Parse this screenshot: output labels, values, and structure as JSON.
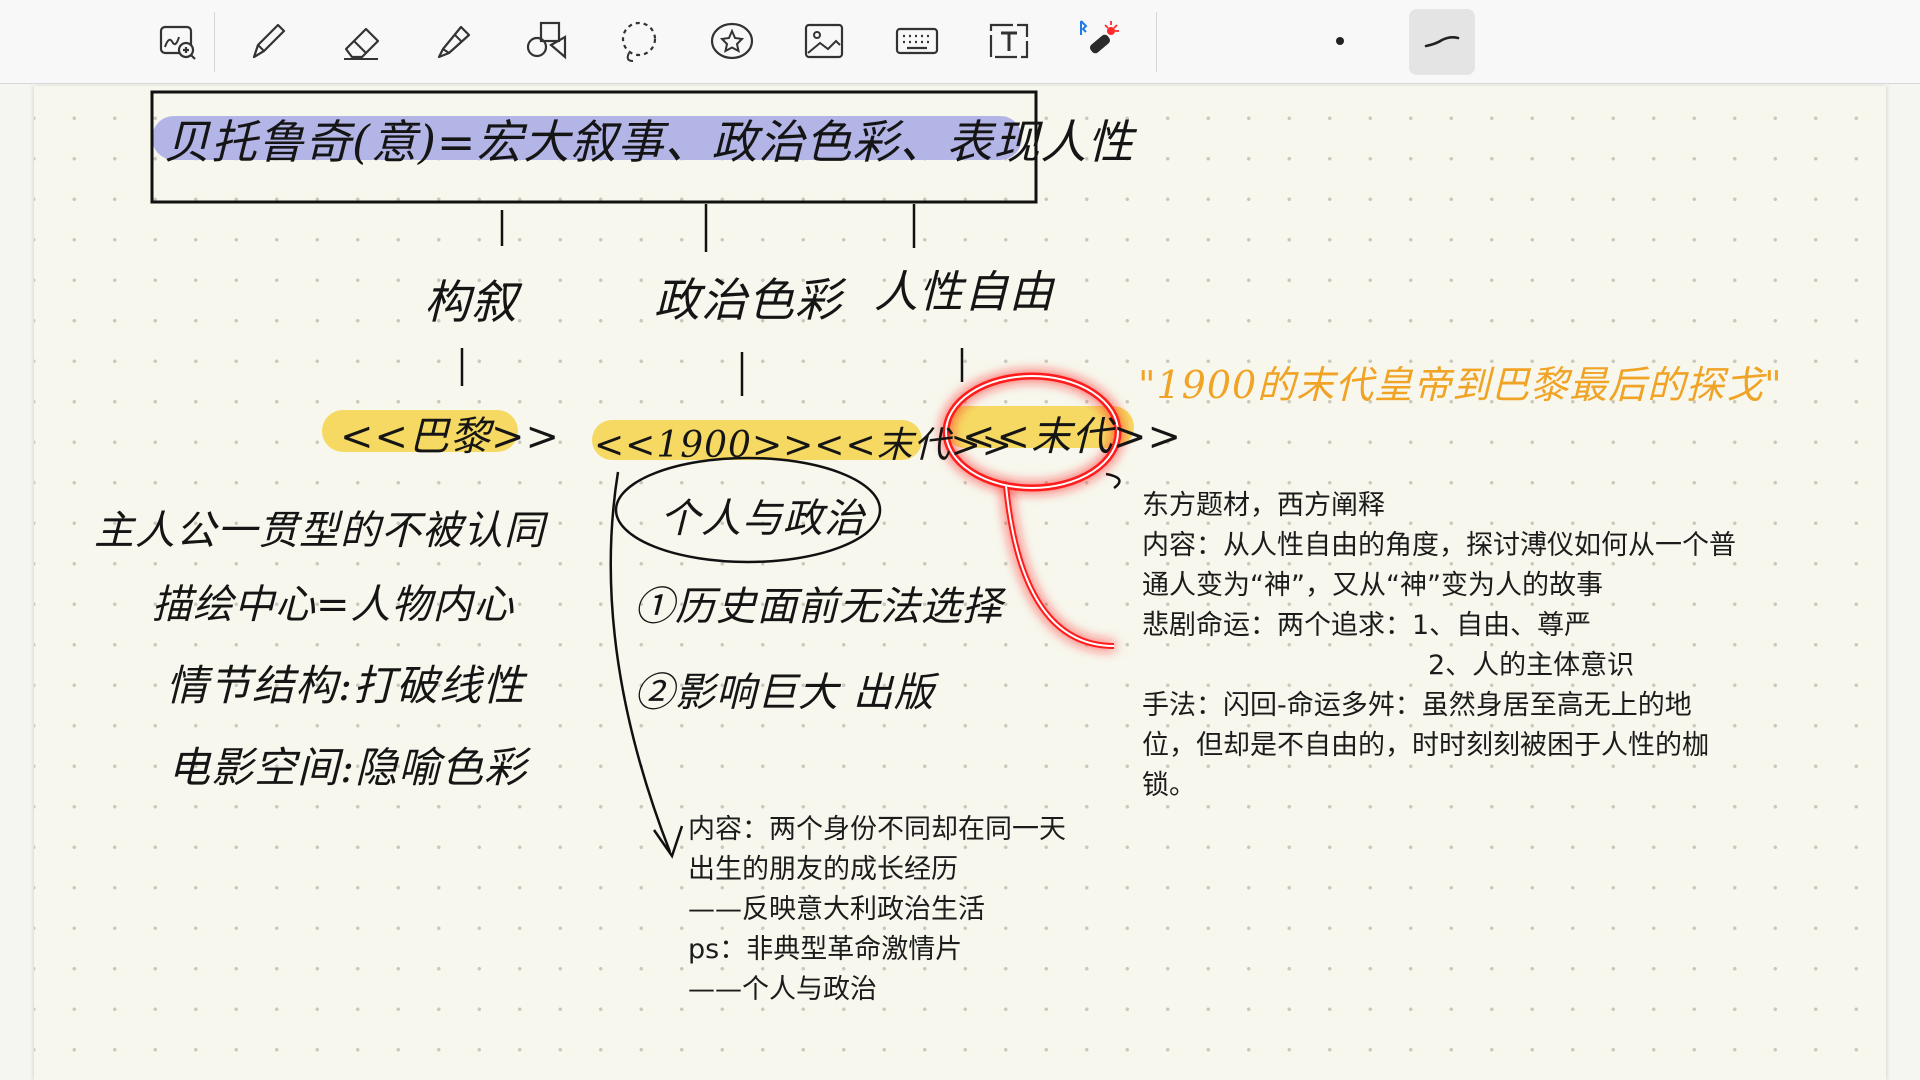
{
  "toolbar": {
    "tools": [
      "zoom-lens",
      "pen",
      "eraser",
      "highlighter",
      "shapes",
      "lasso",
      "stickers",
      "image",
      "keyboard",
      "text",
      "laser-pointer",
      "pen-size",
      "pen-stroke-style"
    ]
  },
  "colors": {
    "ink": "#151515",
    "orange": "#f0a325",
    "highlight_purple": "#b3b5e6",
    "highlight_yellow": "#f6d963",
    "red_glow": "#ff1a1a",
    "paper": "#f7f7ed",
    "dots": "#c9c9bd"
  },
  "handwriting": {
    "title": "贝托鲁奇(意)=宏大叙事、政治色彩、表现人性",
    "branch_1": "构叙",
    "branch_2": "政治色彩",
    "branch_3": "人性自由",
    "film_1": "<<巴黎>>",
    "film_2": "<<1900>><<末代>>",
    "film_3": "<<末代>>",
    "film_1_notes": [
      "主人公一贯型的不被认同",
      "描绘中心=人物内心",
      "情节结构:打破线性",
      "电影空间:隐喻色彩"
    ],
    "circled_theme": "个人与政治",
    "point_1": "①历史面前无法选择",
    "point_2": "②影响巨大 出版",
    "orange_quote": "\"1900的末代皇帝到巴黎最后的探戈\""
  },
  "typed_notes": {
    "right": [
      "东方题材，西方阐释",
      "内容：从人性自由的角度，探讨溥仪如何从一个普",
      "通人变为“神”，又从“神”变为人的故事",
      "悲剧命运：两个追求：1、自由、尊严",
      "2、人的主体意识",
      "手法：闪回-命运多舛：虽然身居至高无上的地",
      "位，但却是不自由的，时时刻刻被困于人性的枷",
      "锁。"
    ],
    "middle": [
      "内容：两个身份不同却在同一天",
      "出生的朋友的成长经历",
      "——反映意大利政治生活",
      "ps：非典型革命激情片",
      "——个人与政治"
    ]
  }
}
